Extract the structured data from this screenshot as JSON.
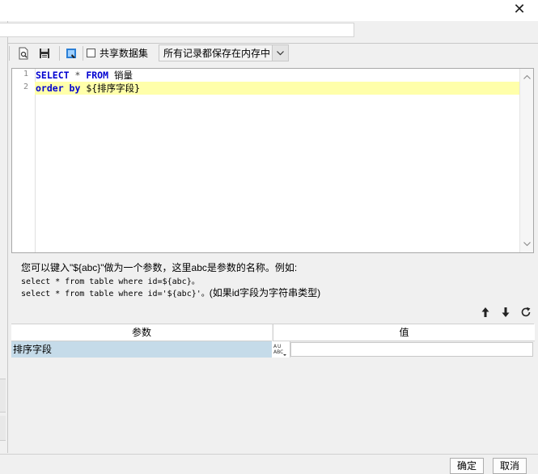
{
  "window": {
    "close_glyph": "✕"
  },
  "toolbar": {
    "icons": [
      "find-icon",
      "save-icon",
      "dataset-icon"
    ],
    "shared_dataset_label": "共享数据集",
    "shared_dataset_checked": false,
    "memory_mode_select": "所有记录都保存在内存中"
  },
  "editor": {
    "line_numbers": [
      "1",
      "2"
    ],
    "line1": {
      "kw1": "SELECT",
      "op": " * ",
      "kw2": "FROM",
      "ident": " 销量"
    },
    "line2": {
      "kw1": "order by",
      "rest": " ${排序字段}"
    }
  },
  "hint": {
    "line1": "您可以键入\"${abc}\"做为一个参数，这里abc是参数的名称。例如:",
    "line2": "select * from table where id=${abc}。",
    "line3a": "select * from table where id='${abc}'。",
    "line3b": "(如果id字段为字符串类型)"
  },
  "actions": [
    "move-up-icon",
    "move-down-icon",
    "refresh-icon"
  ],
  "params_table": {
    "col_param": "参数",
    "col_value": "值",
    "rows": [
      {
        "name": "排序字段",
        "type_icon": "abc-type-icon",
        "value": ""
      }
    ]
  },
  "buttons": {
    "ok": "确定",
    "cancel": "取消"
  }
}
